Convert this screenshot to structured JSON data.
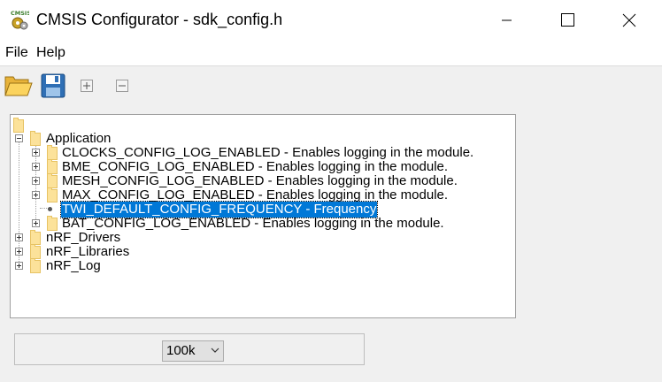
{
  "window": {
    "title": "CMSIS Configurator - sdk_config.h",
    "icon_text": "CMSIS",
    "controls": [
      "minimize",
      "maximize",
      "close"
    ]
  },
  "menu": {
    "items": [
      {
        "label": "File"
      },
      {
        "label": "Help"
      }
    ]
  },
  "toolbar": {
    "buttons": [
      {
        "icon": "open-folder-icon"
      },
      {
        "icon": "save-icon"
      },
      {
        "icon": "expand-all-icon"
      },
      {
        "icon": "collapse-all-icon"
      }
    ]
  },
  "tree": {
    "nodes": [
      {
        "label": "",
        "level": 0,
        "kind": "folder-root"
      },
      {
        "label": "Application",
        "level": 0,
        "expanded": true,
        "kind": "folder"
      },
      {
        "label": "CLOCKS_CONFIG_LOG_ENABLED - Enables logging in the module.",
        "level": 1,
        "expanded": false,
        "kind": "folder"
      },
      {
        "label": "BME_CONFIG_LOG_ENABLED - Enables logging in the module.",
        "level": 1,
        "expanded": false,
        "kind": "folder"
      },
      {
        "label": "MESH_CONFIG_LOG_ENABLED - Enables logging in the module.",
        "level": 1,
        "expanded": false,
        "kind": "folder"
      },
      {
        "label": "MAX_CONFIG_LOG_ENABLED - Enables logging in the module.",
        "level": 1,
        "expanded": false,
        "kind": "folder"
      },
      {
        "label": "TWI_DEFAULT_CONFIG_FREQUENCY  - Frequency",
        "level": 1,
        "kind": "leaf",
        "selected": true
      },
      {
        "label": "BAT_CONFIG_LOG_ENABLED - Enables logging in the module.",
        "level": 1,
        "expanded": false,
        "kind": "folder"
      },
      {
        "label": "nRF_Drivers",
        "level": 0,
        "expanded": false,
        "kind": "folder"
      },
      {
        "label": "nRF_Libraries",
        "level": 0,
        "expanded": false,
        "kind": "folder"
      },
      {
        "label": "nRF_Log",
        "level": 0,
        "expanded": false,
        "kind": "folder"
      }
    ]
  },
  "editor": {
    "value": "100k"
  },
  "colors": {
    "selection": "#0078d7",
    "folder": "#fce29a"
  }
}
